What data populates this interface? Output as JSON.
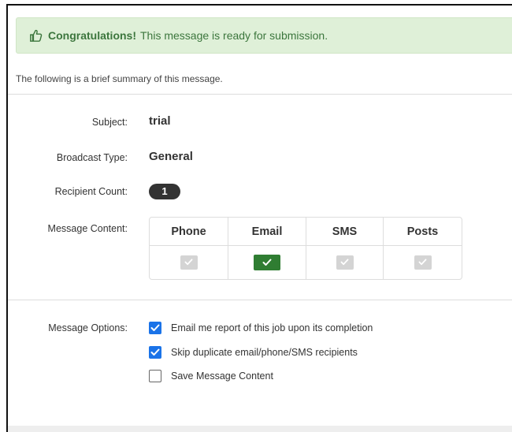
{
  "alert": {
    "strong": "Congratulations!",
    "text": "This message is ready for submission.",
    "icon": "thumbs-up-icon",
    "color": "#3c763d",
    "background": "#dff0d8"
  },
  "summary_text": "The following is a brief summary of this message.",
  "fields": {
    "subject_label": "Subject:",
    "subject_value": "trial",
    "broadcast_label": "Broadcast Type:",
    "broadcast_value": "General",
    "recipient_label": "Recipient Count:",
    "recipient_value": "1",
    "content_label": "Message Content:",
    "options_label": "Message Options:"
  },
  "content_table": {
    "headers": [
      "Phone",
      "Email",
      "SMS",
      "Posts"
    ],
    "enabled": [
      false,
      true,
      false,
      false
    ],
    "active_color": "#2f7d32"
  },
  "options": [
    {
      "label": "Email me report of this job upon its completion",
      "checked": true
    },
    {
      "label": "Skip duplicate email/phone/SMS recipients",
      "checked": true
    },
    {
      "label": "Save Message Content",
      "checked": false
    }
  ]
}
